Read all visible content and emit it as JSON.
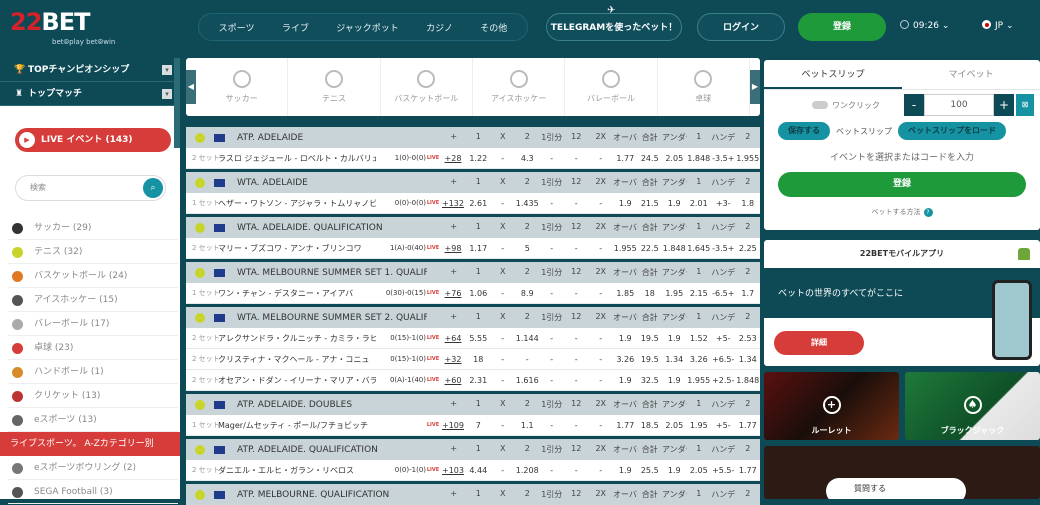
{
  "header": {
    "logo": {
      "main": "BET",
      "prefix": "22",
      "tagline": "bet⦾play bet⦾win"
    },
    "nav": [
      "スポーツ",
      "ライブ",
      "ジャックポット",
      "カジノ",
      "その他"
    ],
    "telegram": "TELEGRAMを使ったベット！",
    "login": "ログイン",
    "register": "登録",
    "time": "09:26",
    "lang": "JP",
    "colors": {
      "bg": "#0d4a56",
      "green": "#1f9a3a",
      "red": "#d63d3a"
    }
  },
  "left": {
    "top_champ": "TOPチャンピオンシップ",
    "top_match": "トップマッチ",
    "live_events": "LIVE イベント (143)",
    "search_placeholder": "検索",
    "sports": [
      {
        "label": "サッカー (29)",
        "color": "#333"
      },
      {
        "label": "テニス (32)",
        "color": "#c9d42a"
      },
      {
        "label": "バスケットボール (24)",
        "color": "#e07a22"
      },
      {
        "label": "アイスホッケー (15)",
        "color": "#555"
      },
      {
        "label": "バレーボール (17)",
        "color": "#aaa"
      },
      {
        "label": "卓球 (23)",
        "color": "#d63d3a"
      },
      {
        "label": "ハンドボール (1)",
        "color": "#d98b2a"
      },
      {
        "label": "クリケット (13)",
        "color": "#b33"
      },
      {
        "label": "eスポーツ (13)",
        "color": "#666"
      }
    ],
    "az_bar": "ライブスポーツ。 A-Zカテゴリー別",
    "sports2": [
      {
        "label": "eスポーツボウリング (2)",
        "color": "#777"
      },
      {
        "label": "SEGA Football (3)",
        "color": "#555"
      }
    ]
  },
  "sport_tabs": [
    "サッカー",
    "テニス",
    "バスケットボール",
    "アイスホッケー",
    "バレーボール",
    "卓球"
  ],
  "columns": [
    "+",
    "1",
    "X",
    "2",
    "1引分",
    "12",
    "2X",
    "オーバー",
    "合計",
    "アンダー",
    "1",
    "ハンデ",
    "2"
  ],
  "leagues": [
    {
      "name": "ATP. ADELAIDE",
      "rows": [
        {
          "set": "2 セット",
          "match": "ラスロ ジェジュール - ロベルト・カルバリェス",
          "score": "1(0)-0(0)",
          "plus": "+28",
          "odds": [
            "1.22",
            "-",
            "4.3",
            "-",
            "-",
            "-",
            "1.77",
            "24.5",
            "2.05",
            "1.848",
            "-3.5+",
            "1.955"
          ]
        }
      ]
    },
    {
      "name": "WTA. ADELAIDE",
      "rows": [
        {
          "set": "1 セット",
          "match": "ヘザー・ワトソン - アジャラ・トムリャノビッチ",
          "score": "0(0)-0(0)",
          "plus": "+132",
          "odds": [
            "2.61",
            "-",
            "1.435",
            "-",
            "-",
            "-",
            "1.9",
            "21.5",
            "1.9",
            "2.01",
            "+3-",
            "1.8"
          ]
        }
      ]
    },
    {
      "name": "WTA. ADELAIDE. QUALIFICATION",
      "rows": [
        {
          "set": "2 セット",
          "match": "マリー・ブズコワ - アンナ・ブリンコワ",
          "score": "1(A)-0(40)",
          "plus": "+98",
          "odds": [
            "1.17",
            "-",
            "5",
            "-",
            "-",
            "-",
            "1.955",
            "22.5",
            "1.848",
            "1.645",
            "-3.5+",
            "2.25"
          ]
        }
      ]
    },
    {
      "name": "WTA. MELBOURNE SUMMER SET 1. QUALIFICATION",
      "rows": [
        {
          "set": "1 セット",
          "match": "ワン・チャン - デスタニー・アイアバ",
          "score": "0(30)-0(15)",
          "plus": "+76",
          "odds": [
            "1.06",
            "-",
            "8.9",
            "-",
            "-",
            "-",
            "1.85",
            "18",
            "1.95",
            "2.15",
            "-6.5+",
            "1.7"
          ]
        }
      ]
    },
    {
      "name": "WTA. MELBOURNE SUMMER SET 2. QUALIFICATION",
      "rows": [
        {
          "set": "2 セット",
          "match": "アレクサンドラ・クルニッチ - カミラ・ラヒモワ",
          "score": "0(15)-1(0)",
          "plus": "+64",
          "odds": [
            "5.55",
            "-",
            "1.144",
            "-",
            "-",
            "-",
            "1.9",
            "19.5",
            "1.9",
            "1.52",
            "+5-",
            "2.53"
          ]
        },
        {
          "set": "2 セット",
          "match": "クリスティナ・マクヘール - アナ・コニュ",
          "score": "0(15)-1(0)",
          "plus": "+32",
          "odds": [
            "18",
            "-",
            "-",
            "-",
            "-",
            "-",
            "3.26",
            "19.5",
            "1.34",
            "3.26",
            "+6.5-",
            "1.34"
          ]
        },
        {
          "set": "2 セット",
          "match": "オセアン・ドダン - イリーナ・マリア・バラ",
          "score": "0(A)-1(40)",
          "plus": "+60",
          "odds": [
            "2.31",
            "-",
            "1.616",
            "-",
            "-",
            "-",
            "1.9",
            "32.5",
            "1.9",
            "1.955",
            "+2.5-",
            "1.848"
          ]
        }
      ]
    },
    {
      "name": "ATP. ADELAIDE. DOUBLES",
      "rows": [
        {
          "set": "1 セット",
          "match": "Mager/ムセッティ - ポール/フチョビッチ",
          "score": "",
          "plus": "+109",
          "odds": [
            "7",
            "-",
            "1.1",
            "-",
            "-",
            "-",
            "1.77",
            "18.5",
            "2.05",
            "1.95",
            "+5-",
            "1.77"
          ]
        }
      ]
    },
    {
      "name": "ATP. ADELAIDE. QUALIFICATION",
      "rows": [
        {
          "set": "2 セット",
          "match": "ダニエル・エルヒ・ガラン・リベロス",
          "score": "0(0)-1(0)",
          "plus": "+103",
          "odds": [
            "4.44",
            "-",
            "1.208",
            "-",
            "-",
            "-",
            "1.9",
            "25.5",
            "1.9",
            "2.05",
            "+5.5-",
            "1.77"
          ]
        }
      ]
    },
    {
      "name": "ATP. MELBOURNE. QUALIFICATION",
      "rows": []
    }
  ],
  "right": {
    "tab_betslip": "ベットスリップ",
    "tab_my": "マイベット",
    "one_click": "ワンクリック",
    "stake": "100",
    "save": "保存する",
    "betslip_label": "ベットスリップ",
    "load": "ベットスリップをロード",
    "enter_code": "イベントを選択またはコードを入力",
    "register": "登録",
    "howto": "ベットする方法",
    "mobile_title": "22BETモバイルアプリ",
    "mobile_tag": "ベットの世界のすべてがここに",
    "details": "詳細",
    "roulette": "ルーレット",
    "blackjack": "ブラックジャック",
    "ask": "質問する"
  }
}
